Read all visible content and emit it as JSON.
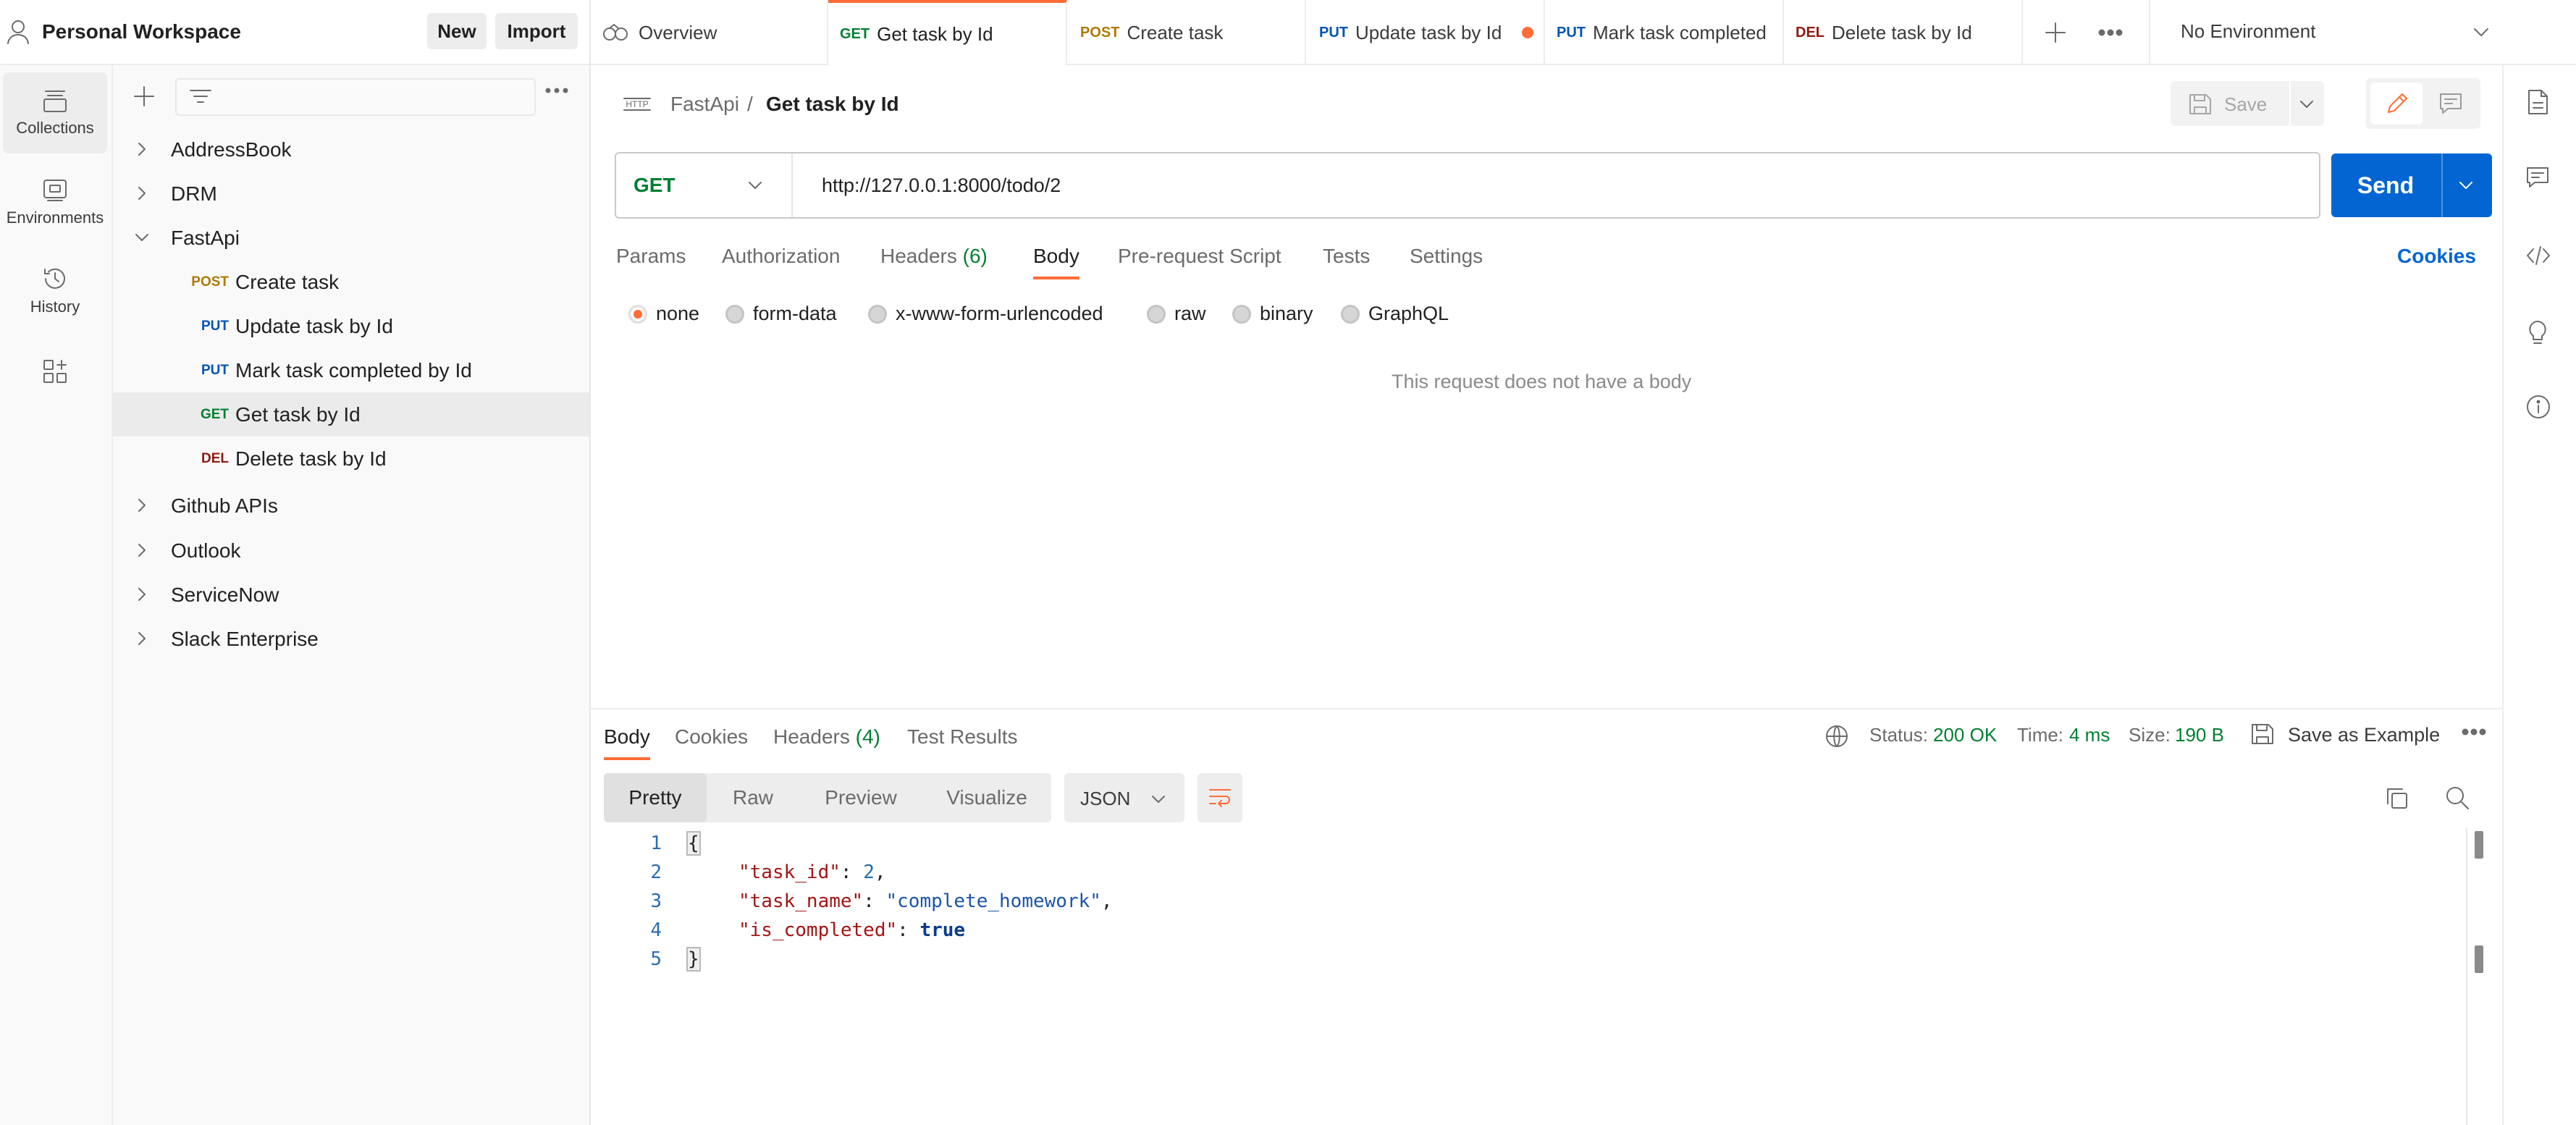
{
  "workspace": {
    "name": "Personal Workspace",
    "new_label": "New",
    "import_label": "Import"
  },
  "rail": {
    "items": [
      {
        "label": "Collections",
        "icon": "collections-icon"
      },
      {
        "label": "Environments",
        "icon": "environments-icon"
      },
      {
        "label": "History",
        "icon": "history-icon"
      },
      {
        "label": "",
        "icon": "add-apps-icon"
      }
    ]
  },
  "sidebar": {
    "search_placeholder": "",
    "tree": [
      {
        "label": "AddressBook",
        "expanded": false
      },
      {
        "label": "DRM",
        "expanded": false
      },
      {
        "label": "FastApi",
        "expanded": true
      },
      {
        "method": "POST",
        "label": "Create task"
      },
      {
        "method": "PUT",
        "label": "Update task by Id"
      },
      {
        "method": "PUT",
        "label": "Mark task completed by Id"
      },
      {
        "method": "GET",
        "label": "Get task by Id"
      },
      {
        "method": "DEL",
        "label": "Delete task by Id"
      },
      {
        "label": "Github APIs",
        "expanded": false
      },
      {
        "label": "Outlook",
        "expanded": false
      },
      {
        "label": "ServiceNow",
        "expanded": false
      },
      {
        "label": "Slack Enterprise",
        "expanded": false
      }
    ]
  },
  "tabs": [
    {
      "label": "Overview"
    },
    {
      "method": "GET",
      "label": "Get task by Id"
    },
    {
      "method": "POST",
      "label": "Create task"
    },
    {
      "method": "PUT",
      "label": "Update task by Id"
    },
    {
      "method": "PUT",
      "label": "Mark task completed"
    },
    {
      "method": "DEL",
      "label": "Delete task by Id"
    }
  ],
  "environment": {
    "label": "No Environment"
  },
  "request": {
    "breadcrumb_collection": "FastApi",
    "breadcrumb_sep": "/",
    "title": "Get task by Id",
    "save_label": "Save",
    "method": "GET",
    "url": "http://127.0.0.1:8000/todo/2",
    "send_label": "Send",
    "tabs": [
      {
        "label": "Params"
      },
      {
        "label": "Authorization"
      },
      {
        "label": "Headers",
        "count": "(6)"
      },
      {
        "label": "Body"
      },
      {
        "label": "Pre-request Script"
      },
      {
        "label": "Tests"
      },
      {
        "label": "Settings"
      }
    ],
    "cookies_label": "Cookies",
    "body_types": [
      "none",
      "form-data",
      "x-www-form-urlencoded",
      "raw",
      "binary",
      "GraphQL"
    ],
    "no_body_text": "This request does not have a body"
  },
  "response": {
    "tabs": [
      {
        "label": "Body"
      },
      {
        "label": "Cookies"
      },
      {
        "label": "Headers",
        "count": "(4)"
      },
      {
        "label": "Test Results"
      }
    ],
    "status_label": "Status:",
    "status_value": "200 OK",
    "time_label": "Time:",
    "time_value": "4 ms",
    "size_label": "Size:",
    "size_value": "190 B",
    "save_example_label": "Save as Example",
    "views": [
      "Pretty",
      "Raw",
      "Preview",
      "Visualize"
    ],
    "format": "JSON",
    "line_numbers": [
      "1",
      "2",
      "3",
      "4",
      "5"
    ],
    "json": {
      "open": "{",
      "k1": "\"task_id\"",
      "v1": "2",
      "k2": "\"task_name\"",
      "v2": "\"complete_homework\"",
      "k3": "\"is_completed\"",
      "v3": "true",
      "close": "}",
      "colon": ": ",
      "comma": ","
    }
  },
  "colors": {
    "accent": "#ff6c37",
    "send": "#0265d2",
    "get": "#007f31",
    "post": "#ad7a03",
    "put": "#0053b8",
    "del": "#8e1a10"
  }
}
